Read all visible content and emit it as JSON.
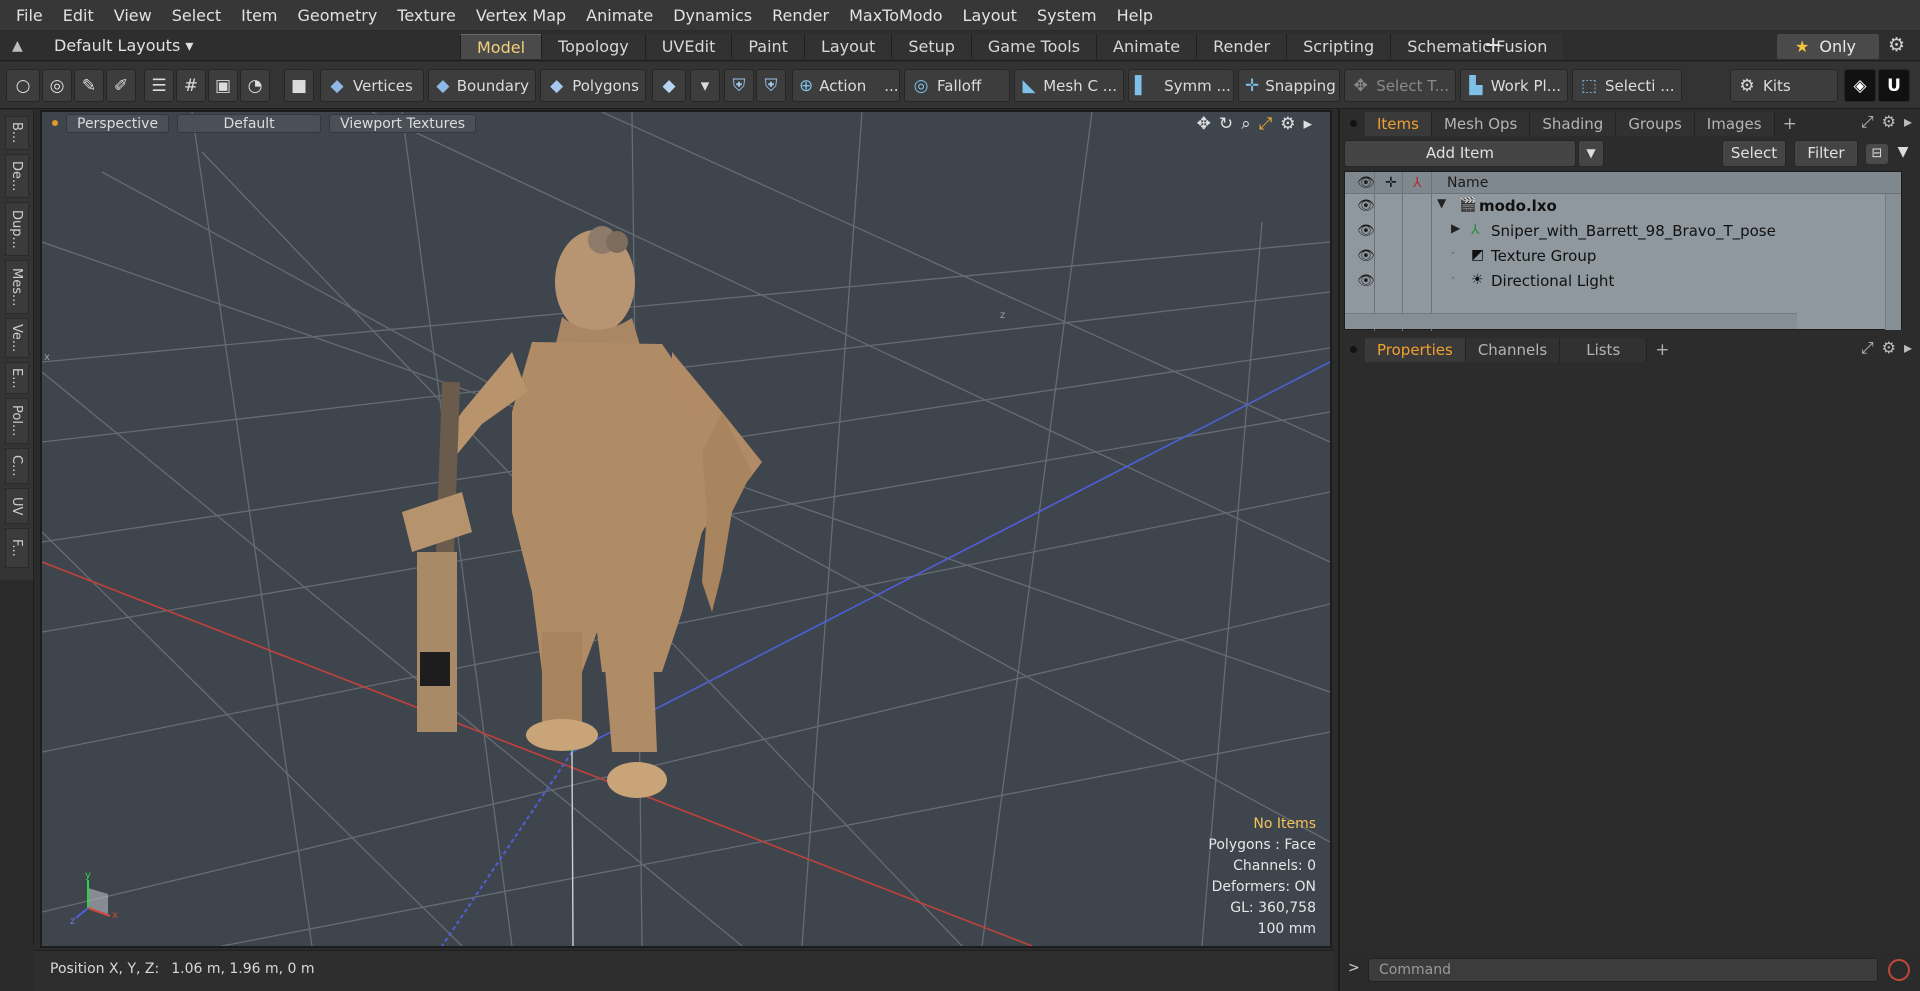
{
  "menubar": [
    "File",
    "Edit",
    "View",
    "Select",
    "Item",
    "Geometry",
    "Texture",
    "Vertex Map",
    "Animate",
    "Dynamics",
    "Render",
    "MaxToModo",
    "Layout",
    "System",
    "Help"
  ],
  "layoutbar": {
    "layouts_label": "Default Layouts ▾",
    "tabs": [
      "Model",
      "Topology",
      "UVEdit",
      "Paint",
      "Layout",
      "Setup",
      "Game Tools",
      "Animate",
      "Render",
      "Scripting",
      "Schematic Fusion"
    ],
    "active_tab": "Model",
    "plus": "+",
    "only_label": "Only"
  },
  "toolbar": {
    "vertices": "Vertices",
    "boundary": "Boundary",
    "polygons": "Polygons",
    "action": "Action",
    "action_more": "...",
    "falloff": "Falloff",
    "mesh_c": "Mesh C ...",
    "symm": "Symm ...",
    "snapping": "Snapping",
    "select_t": "Select T...",
    "work_pl": "Work Pl...",
    "selecti": "Selecti ...",
    "kits": "Kits"
  },
  "leftstrip": [
    "B...",
    "De...",
    "Dup...",
    "Mes...",
    "Ve...",
    "E...",
    "Pol...",
    "C...",
    "UV",
    "F..."
  ],
  "viewport": {
    "view": "Perspective",
    "shading": "Default",
    "textures": "Viewport Textures",
    "stats": {
      "selection": "No Items",
      "polygons": "Polygons : Face",
      "channels": "Channels: 0",
      "deformers": "Deformers: ON",
      "gl": "GL: 360,758",
      "scale": "100 mm"
    }
  },
  "statusbar": {
    "label": "Position X, Y, Z:",
    "value": "1.06 m, 1.96 m, 0 m"
  },
  "items_panel": {
    "tabs": [
      "Items",
      "Mesh Ops",
      "Shading",
      "Groups",
      "Images"
    ],
    "active": "Items",
    "add_item": "Add Item",
    "select": "Select",
    "filter": "Filter",
    "name_header": "Name",
    "rows": [
      {
        "label": "modo.lxo"
      },
      {
        "label": "Sniper_with_Barrett_98_Bravo_T_pose"
      },
      {
        "label": "Texture Group"
      },
      {
        "label": "Directional Light"
      }
    ]
  },
  "properties_panel": {
    "tabs": [
      "Properties",
      "Channels",
      "Lists"
    ],
    "active": "Properties"
  },
  "command": {
    "placeholder": "Command"
  },
  "colors": {
    "accent": "#f0a030",
    "viewport_bg": "#3f454d",
    "tree_bg": "#8f989f"
  }
}
